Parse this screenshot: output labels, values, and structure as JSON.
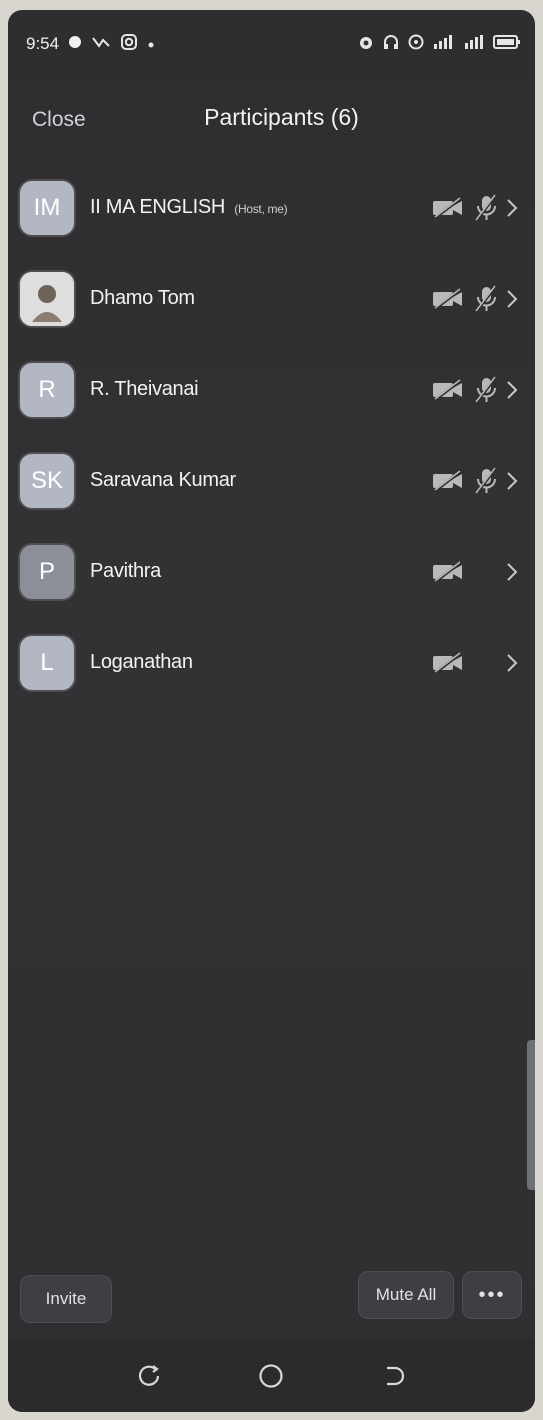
{
  "statusbar": {
    "time": "9:54"
  },
  "header": {
    "close_label": "Close",
    "title": "Participants (6)"
  },
  "participants": [
    {
      "initials": "IM",
      "name": "II MA ENGLISH",
      "tag": "(Host, me)",
      "video_muted": true,
      "audio_muted": true
    },
    {
      "initials": "",
      "name": "Dhamo Tom",
      "tag": "",
      "video_muted": true,
      "audio_muted": true
    },
    {
      "initials": "R",
      "name": "R. Theivanai",
      "tag": "",
      "video_muted": true,
      "audio_muted": true
    },
    {
      "initials": "SK",
      "name": "Saravana Kumar",
      "tag": "",
      "video_muted": true,
      "audio_muted": true
    },
    {
      "initials": "P",
      "name": "Pavithra",
      "tag": "",
      "video_muted": true,
      "audio_muted": false
    },
    {
      "initials": "L",
      "name": "Loganathan",
      "tag": "",
      "video_muted": true,
      "audio_muted": false
    }
  ],
  "footer": {
    "invite_label": "Invite",
    "mute_all_label": "Mute All",
    "more_label": "•••"
  },
  "icons": {
    "video_off": "video-off-icon",
    "mic_off": "mic-off-icon",
    "chevron": "chevron-right-icon"
  }
}
